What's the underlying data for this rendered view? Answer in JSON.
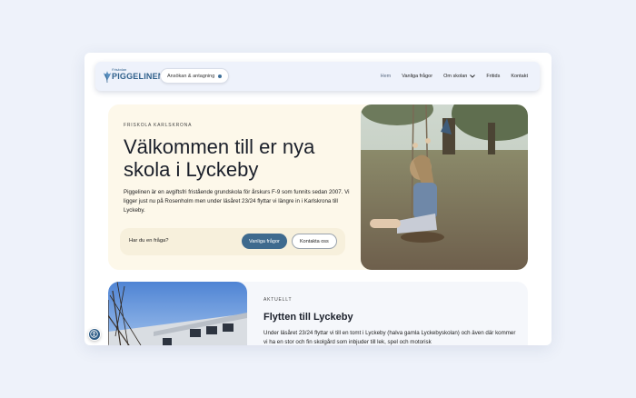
{
  "nav": {
    "logo_small": "Friskolan",
    "logo_main": "PIGGELINEN",
    "apply_label": "Ansökan & antagning",
    "items": [
      {
        "label": "Hem"
      },
      {
        "label": "Vanliga frågor"
      },
      {
        "label": "Om skolan"
      },
      {
        "label": "Fritids"
      },
      {
        "label": "Kontakt"
      }
    ]
  },
  "hero": {
    "eyebrow": "FRISKOLA KARLSKRONA",
    "title": "Välkommen till er nya skola i Lyckeby",
    "text": "Piggelinen är en avgiftsfri fristående grundskola för årskurs F-9 som funnits sedan 2007. Vi ligger just nu på Rosenholm men under läsåret 23/24 flyttar vi längre in i Karlskrona till Lyckeby.",
    "question_label": "Har du en fråga?",
    "faq_button": "Vanliga frågor",
    "contact_button": "Kontakta oss"
  },
  "news": {
    "eyebrow": "AKTUELLT",
    "title": "Flytten till Lyckeby",
    "text": "Under läsåret 23/24 flyttar vi till en tomt i Lyckeby (halva gamla Lyckebyskolan) och även där kommer vi ha en stor och fin skolgård som inbjuder till lek, spel och motorisk"
  },
  "colors": {
    "accent": "#3e6a8e",
    "hero_bg": "#fdf8ea",
    "page_bg": "#eef2fa"
  },
  "icons": {
    "logo": "crocus-flower-icon",
    "apply_dot": "dot-icon",
    "dropdown": "chevron-down-icon",
    "accessibility": "accessibility-icon"
  }
}
